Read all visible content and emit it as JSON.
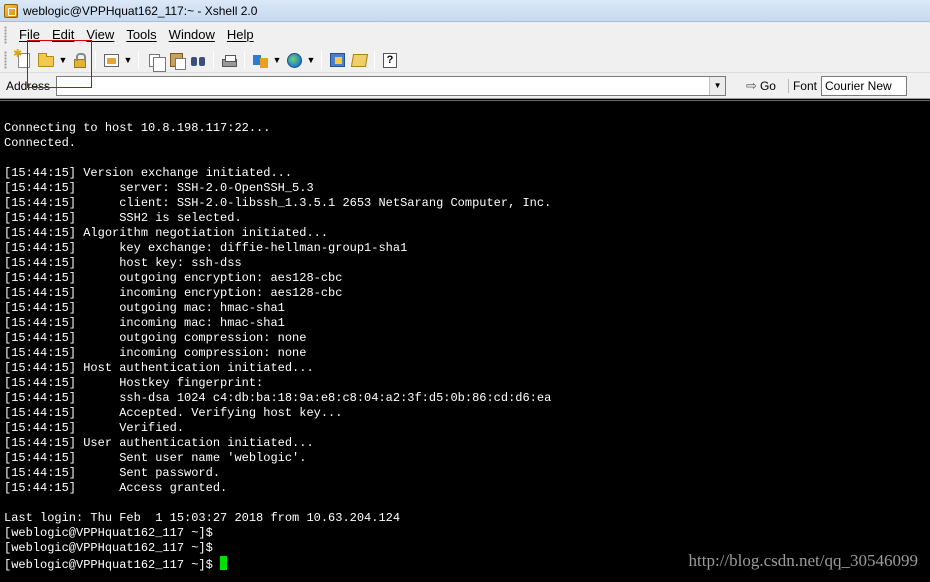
{
  "window": {
    "title": "weblogic@VPPHquat162_117:~ - Xshell 2.0"
  },
  "menu": [
    "File",
    "Edit",
    "View",
    "Tools",
    "Window",
    "Help"
  ],
  "toolbar": {
    "buttons": [
      {
        "name": "new-session",
        "icon": "new-file-icon"
      },
      {
        "name": "open-session",
        "icon": "folder-icon"
      },
      {
        "name": "open-dropdown",
        "icon": "chevron-down-icon"
      },
      {
        "name": "reconnect",
        "icon": "lock-icon"
      },
      {
        "name": "properties",
        "icon": "properties-icon"
      },
      {
        "name": "properties-dropdown",
        "icon": "chevron-down-icon"
      },
      {
        "name": "copy",
        "icon": "copy-icon"
      },
      {
        "name": "paste",
        "icon": "paste-icon"
      },
      {
        "name": "find",
        "icon": "binoculars-icon"
      },
      {
        "name": "print",
        "icon": "printer-icon"
      },
      {
        "name": "transfer",
        "icon": "transfer-icon"
      },
      {
        "name": "transfer-dropdown",
        "icon": "chevron-down-icon"
      },
      {
        "name": "encoding",
        "icon": "globe-icon"
      },
      {
        "name": "encoding-dropdown",
        "icon": "chevron-down-icon"
      },
      {
        "name": "xftp",
        "icon": "xftp-icon"
      },
      {
        "name": "compose",
        "icon": "compose-icon"
      },
      {
        "name": "help",
        "icon": "help-icon"
      }
    ]
  },
  "address": {
    "label": "Address",
    "value": "",
    "go_label": "Go"
  },
  "font": {
    "label": "Font",
    "value": "Courier New"
  },
  "terminal": {
    "lines": [
      "Connecting to host 10.8.198.117:22...",
      "Connected.",
      "",
      "[15:44:15] Version exchange initiated...",
      "[15:44:15]      server: SSH-2.0-OpenSSH_5.3",
      "[15:44:15]      client: SSH-2.0-libssh_1.3.5.1 2653 NetSarang Computer, Inc.",
      "[15:44:15]      SSH2 is selected.",
      "[15:44:15] Algorithm negotiation initiated...",
      "[15:44:15]      key exchange: diffie-hellman-group1-sha1",
      "[15:44:15]      host key: ssh-dss",
      "[15:44:15]      outgoing encryption: aes128-cbc",
      "[15:44:15]      incoming encryption: aes128-cbc",
      "[15:44:15]      outgoing mac: hmac-sha1",
      "[15:44:15]      incoming mac: hmac-sha1",
      "[15:44:15]      outgoing compression: none",
      "[15:44:15]      incoming compression: none",
      "[15:44:15] Host authentication initiated...",
      "[15:44:15]      Hostkey fingerprint:",
      "[15:44:15]      ssh-dsa 1024 c4:db:ba:18:9a:e8:c8:04:a2:3f:d5:0b:86:cd:d6:ea",
      "[15:44:15]      Accepted. Verifying host key...",
      "[15:44:15]      Verified.",
      "[15:44:15] User authentication initiated...",
      "[15:44:15]      Sent user name 'weblogic'.",
      "[15:44:15]      Sent password.",
      "[15:44:15]      Access granted.",
      "",
      "Last login: Thu Feb  1 15:03:27 2018 from 10.63.204.124",
      "[weblogic@VPPHquat162_117 ~]$",
      "[weblogic@VPPHquat162_117 ~]$",
      "[weblogic@VPPHquat162_117 ~]$ "
    ]
  },
  "watermark": "http://blog.csdn.net/qq_30546099",
  "colors": {
    "terminal_bg": "#000000",
    "terminal_fg": "#ffffff",
    "cursor": "#00e000",
    "highlight": "#e00000"
  }
}
